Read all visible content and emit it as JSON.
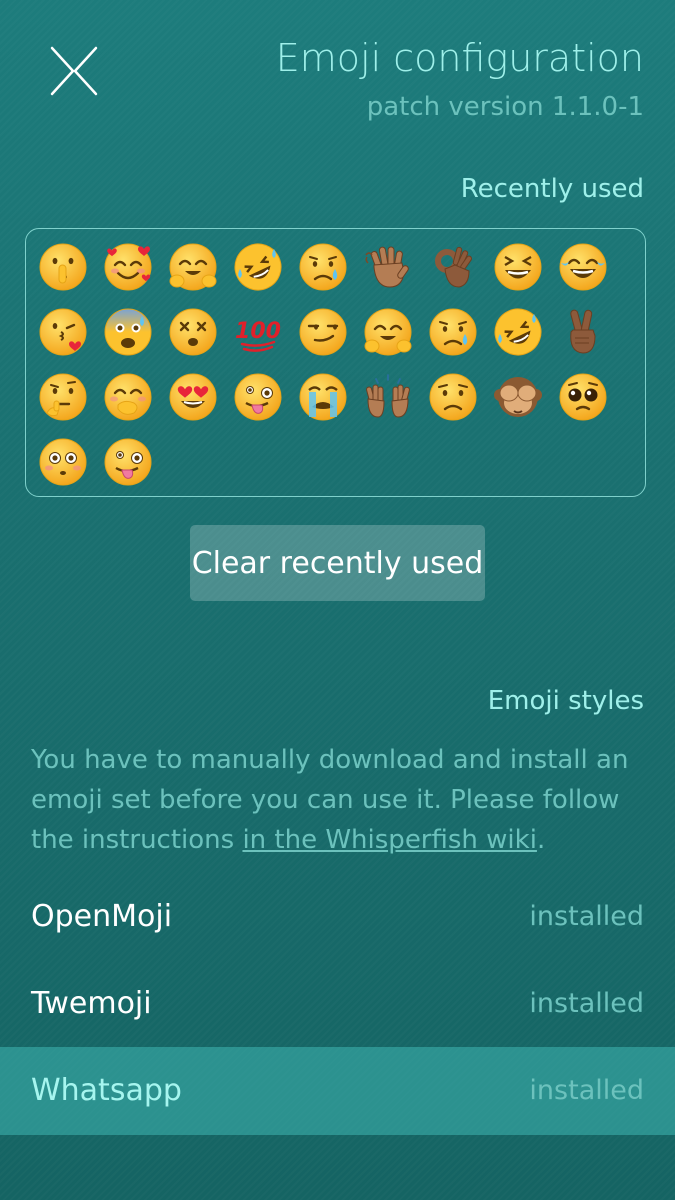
{
  "header": {
    "close_icon": "close-icon",
    "title": "Emoji configuration",
    "subtitle": "patch version 1.1.0-1"
  },
  "recent": {
    "header": "Recently used",
    "emojis": [
      {
        "name": "shushing-face",
        "glyph": "🤫"
      },
      {
        "name": "smiling-face-with-hearts",
        "glyph": "🥰"
      },
      {
        "name": "hugging-face",
        "glyph": "🤗"
      },
      {
        "name": "rolling-on-the-floor-laughing",
        "glyph": "🤣"
      },
      {
        "name": "sad-but-relieved-face",
        "glyph": "😥"
      },
      {
        "name": "waving-hand-medium-skin",
        "glyph": "👋🏽"
      },
      {
        "name": "ok-hand-medium-dark-skin",
        "glyph": "👌🏾"
      },
      {
        "name": "grinning-squinting-face",
        "glyph": "😆"
      },
      {
        "name": "face-with-tears-of-joy",
        "glyph": "😂"
      },
      {
        "name": "face-blowing-a-kiss",
        "glyph": "😘"
      },
      {
        "name": "anxious-face-with-sweat",
        "glyph": "😰"
      },
      {
        "name": "dizzy-face",
        "glyph": "😵"
      },
      {
        "name": "hundred-points",
        "glyph": "💯"
      },
      {
        "name": "smirking-face",
        "glyph": "😏"
      },
      {
        "name": "hugging-face",
        "glyph": "🤗"
      },
      {
        "name": "sad-but-relieved-face",
        "glyph": "😥"
      },
      {
        "name": "rolling-on-the-floor-laughing",
        "glyph": "🤣"
      },
      {
        "name": "victory-hand-medium-dark-skin",
        "glyph": "✌🏾"
      },
      {
        "name": "thinking-face",
        "glyph": "🤔"
      },
      {
        "name": "face-with-hand-over-mouth",
        "glyph": "🤭"
      },
      {
        "name": "smiling-face-with-heart-eyes",
        "glyph": "😍"
      },
      {
        "name": "zany-face",
        "glyph": "🤪"
      },
      {
        "name": "loudly-crying-face",
        "glyph": "😭"
      },
      {
        "name": "raising-hands-medium-skin",
        "glyph": "🙌🏽"
      },
      {
        "name": "worried-face",
        "glyph": "😟"
      },
      {
        "name": "see-no-evil-monkey",
        "glyph": "🙈"
      },
      {
        "name": "pleading-face",
        "glyph": "🥺"
      },
      {
        "name": "flushed-face",
        "glyph": "😳"
      },
      {
        "name": "zany-face",
        "glyph": "🤪"
      }
    ],
    "clear_label": "Clear recently used"
  },
  "styles": {
    "header": "Emoji styles",
    "info_text": "You have to manually download and install an emoji set before you can use it. Please follow the instructions ",
    "info_link": "in the Whisperfish wiki",
    "info_end": ".",
    "items": [
      {
        "name": "OpenMoji",
        "status": "installed",
        "selected": false
      },
      {
        "name": "Twemoji",
        "status": "installed",
        "selected": false
      },
      {
        "name": "Whatsapp",
        "status": "installed",
        "selected": true
      }
    ]
  },
  "colors": {
    "accent": "#9ff0ea",
    "secondary": "#6cc2bd",
    "selected_row": "#3fa8a5"
  }
}
